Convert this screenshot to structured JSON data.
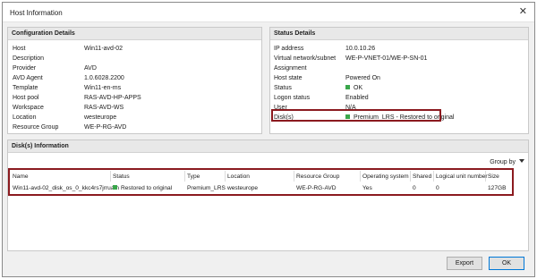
{
  "window": {
    "title": "Host Information"
  },
  "config": {
    "title": "Configuration Details",
    "rows": [
      {
        "label": "Host",
        "value": "Win11-avd-02"
      },
      {
        "label": "Description",
        "value": ""
      },
      {
        "label": "Provider",
        "value": "AVD"
      },
      {
        "label": "AVD Agent",
        "value": "1.0.6028.2200"
      },
      {
        "label": "Template",
        "value": "Win11-en-ms"
      },
      {
        "label": "Host pool",
        "value": "RAS-AVD-HP-APPS"
      },
      {
        "label": "Workspace",
        "value": "RAS-AVD-WS"
      },
      {
        "label": "Location",
        "value": "westeurope"
      },
      {
        "label": "Resource Group",
        "value": "WE-P-RG-AVD"
      }
    ]
  },
  "status": {
    "title": "Status Details",
    "rows": [
      {
        "label": "IP address",
        "value": "10.0.10.26"
      },
      {
        "label": "Virtual network/subnet",
        "value": "WE-P-VNET-01/WE-P-SN-01"
      },
      {
        "label": "Assignment",
        "value": ""
      },
      {
        "label": "Host state",
        "value": "Powered On"
      },
      {
        "label": "Status",
        "value": "OK"
      },
      {
        "label": "Logon status",
        "value": "Enabled"
      },
      {
        "label": "User",
        "value": "N/A"
      },
      {
        "label": "Disk(s)",
        "value": "Premium_LRS - Restored to original"
      }
    ],
    "ok_color": "#3aa64b"
  },
  "disks": {
    "title": "Disk(s) Information",
    "group_by": "Group by",
    "columns": [
      "Name",
      "Status",
      "Type",
      "Location",
      "Resource Group",
      "Operating system",
      "Shared",
      "Logical unit number",
      "Size"
    ],
    "rows": [
      [
        "Win11-avd-02_disk_os_0_kkc4rs7jrruam",
        "Restored to original",
        "Premium_LRS",
        "westeurope",
        "WE-P-RG-AVD",
        "Yes",
        "0",
        "0",
        "127GB"
      ]
    ]
  },
  "buttons": {
    "export": "Export",
    "ok": "OK"
  },
  "highlight_color": "#8b1a1f"
}
